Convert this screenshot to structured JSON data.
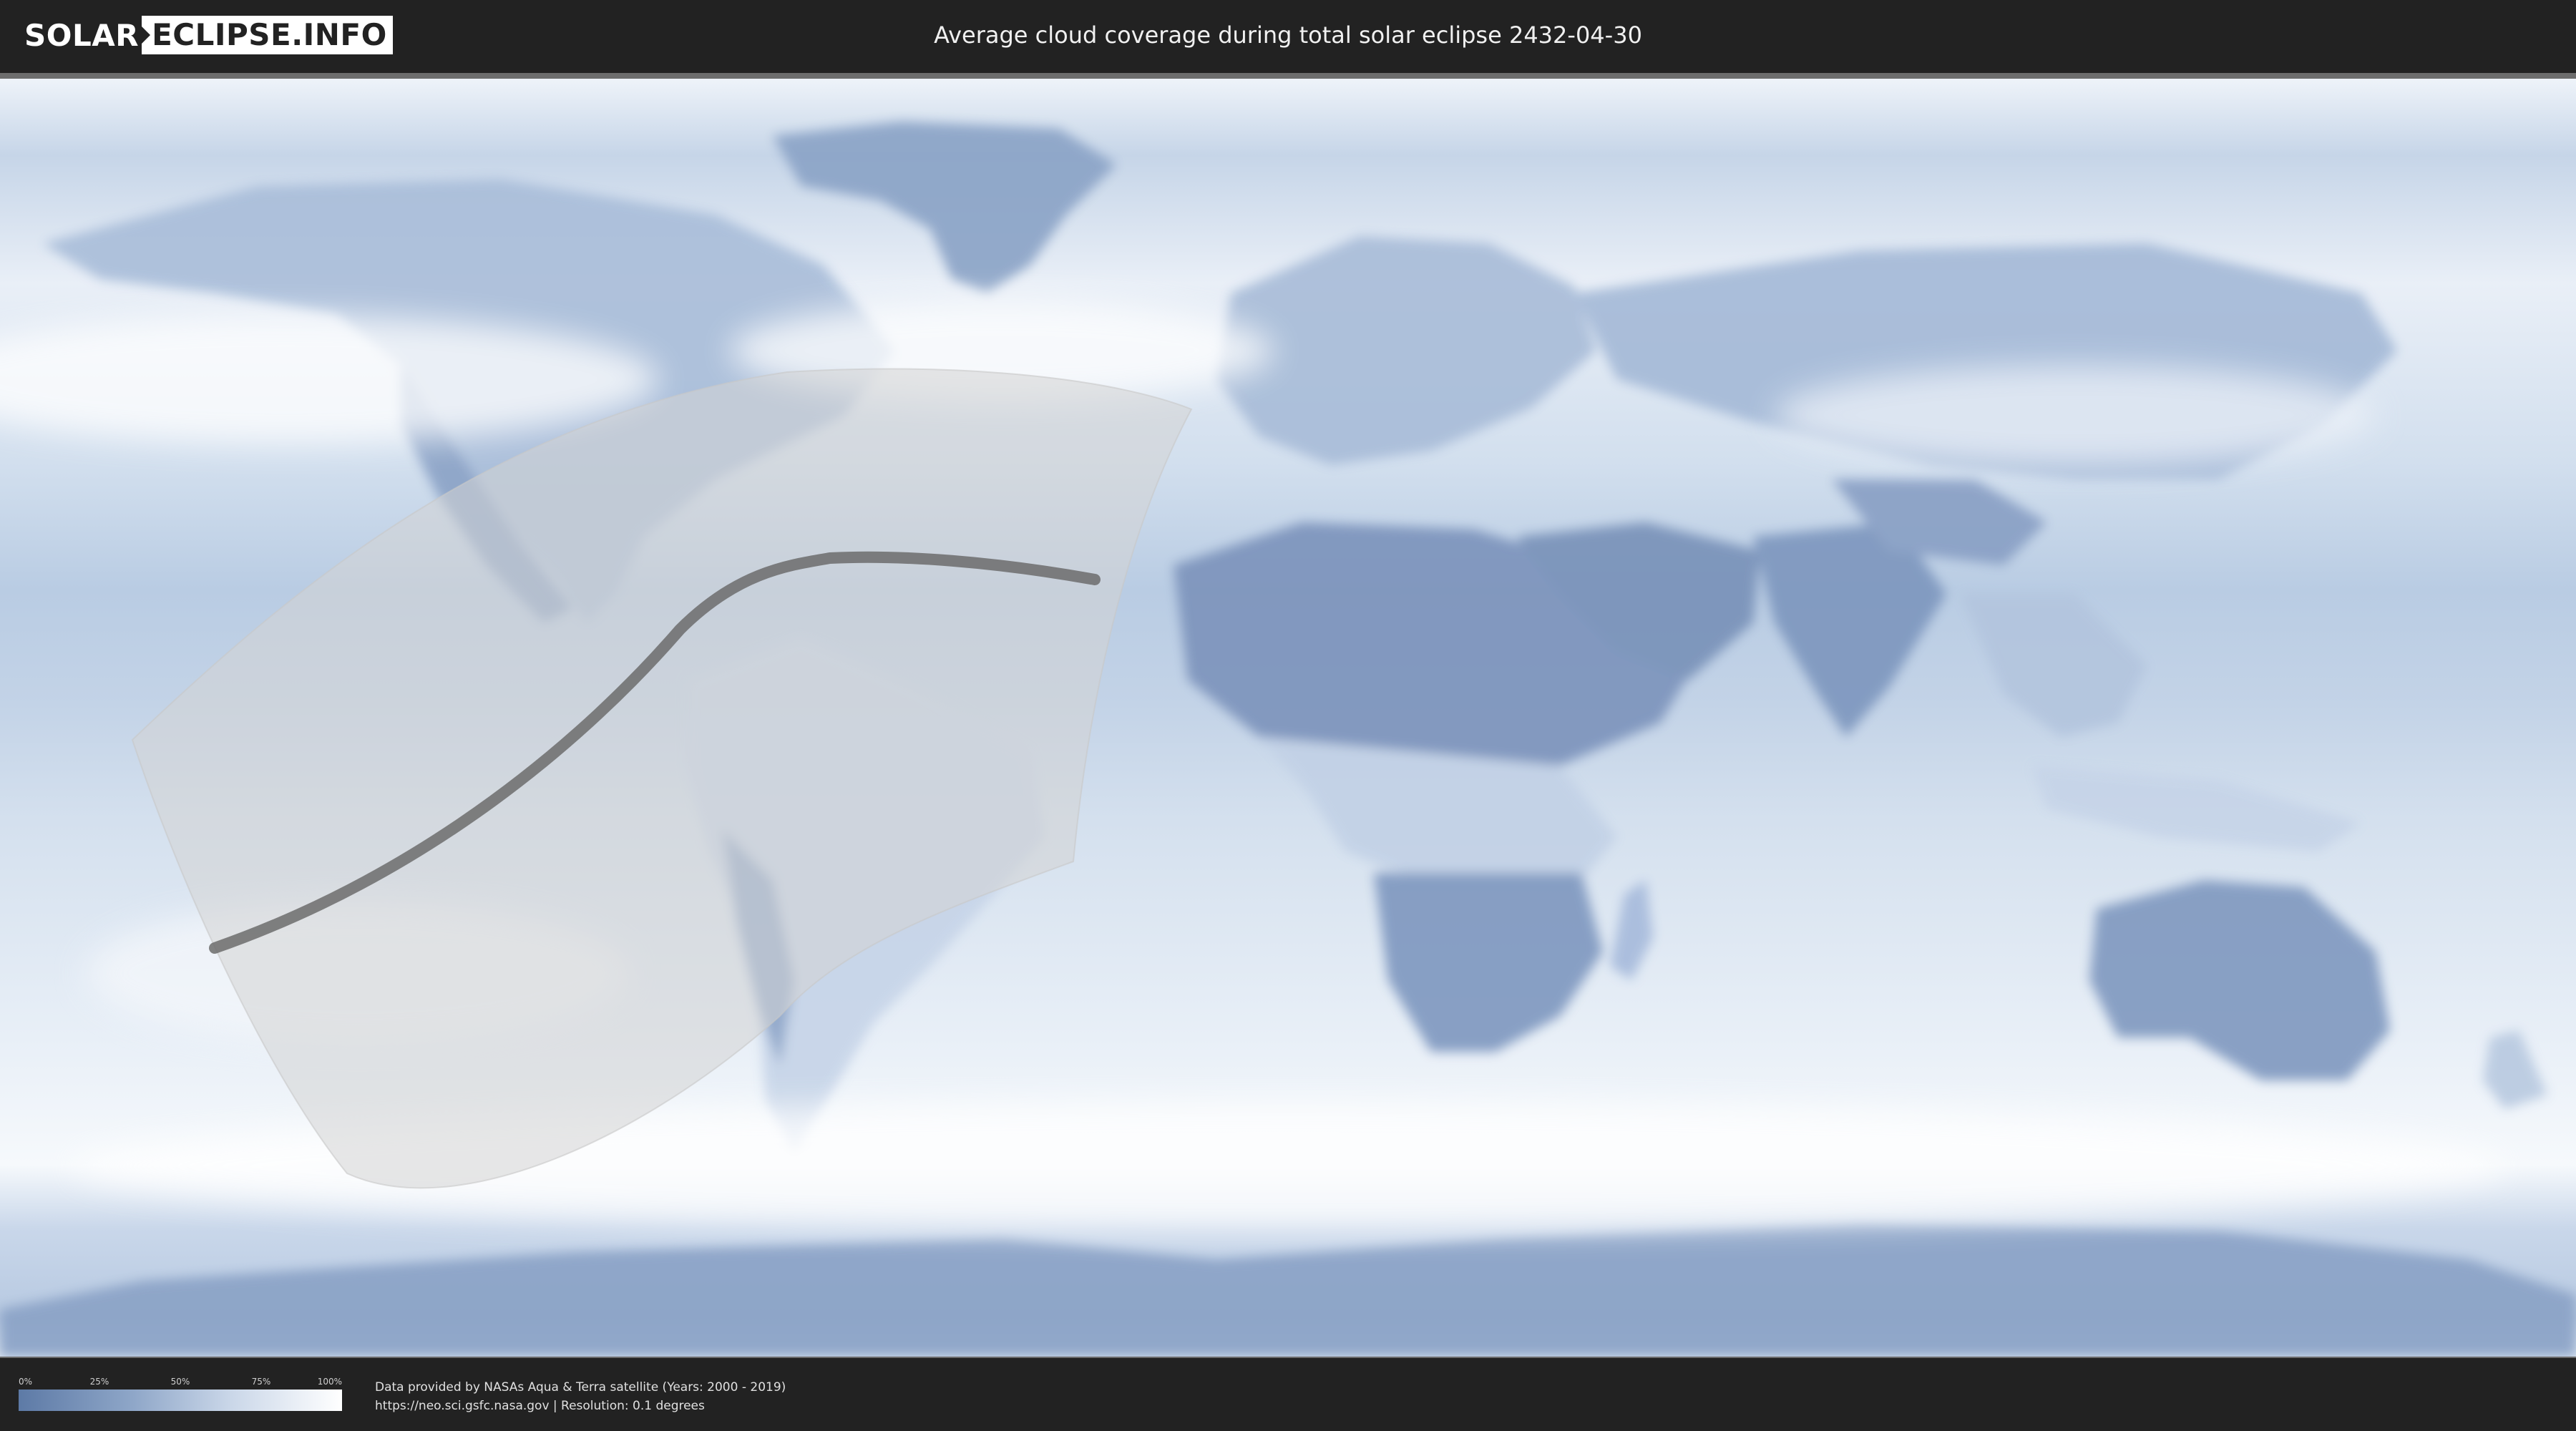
{
  "header": {
    "logo_part1": "SOLAR",
    "logo_part2": "ECLIPSE.INFO",
    "title": "Average cloud coverage during total solar eclipse 2432-04-30"
  },
  "legend": {
    "ticks": [
      {
        "label": "0%",
        "fraction": 0.0
      },
      {
        "label": "25%",
        "fraction": 0.25
      },
      {
        "label": "50%",
        "fraction": 0.5
      },
      {
        "label": "75%",
        "fraction": 0.75
      },
      {
        "label": "100%",
        "fraction": 1.0
      }
    ],
    "color_low": "#5d7aa6",
    "color_high": "#ffffff"
  },
  "credits": {
    "line1": "Data provided by NASAs Aqua & Terra satellite (Years: 2000 - 2019)",
    "line2": "https://neo.sci.gsfc.nasa.gov | Resolution: 0.1 degrees"
  },
  "colors": {
    "background": "#222222",
    "ocean_cloud": "#dfe8f3",
    "land_low_cloud": "#7891b8",
    "eclipse_zone": "#d3d3d3",
    "central_path": "#6c6c6c"
  }
}
